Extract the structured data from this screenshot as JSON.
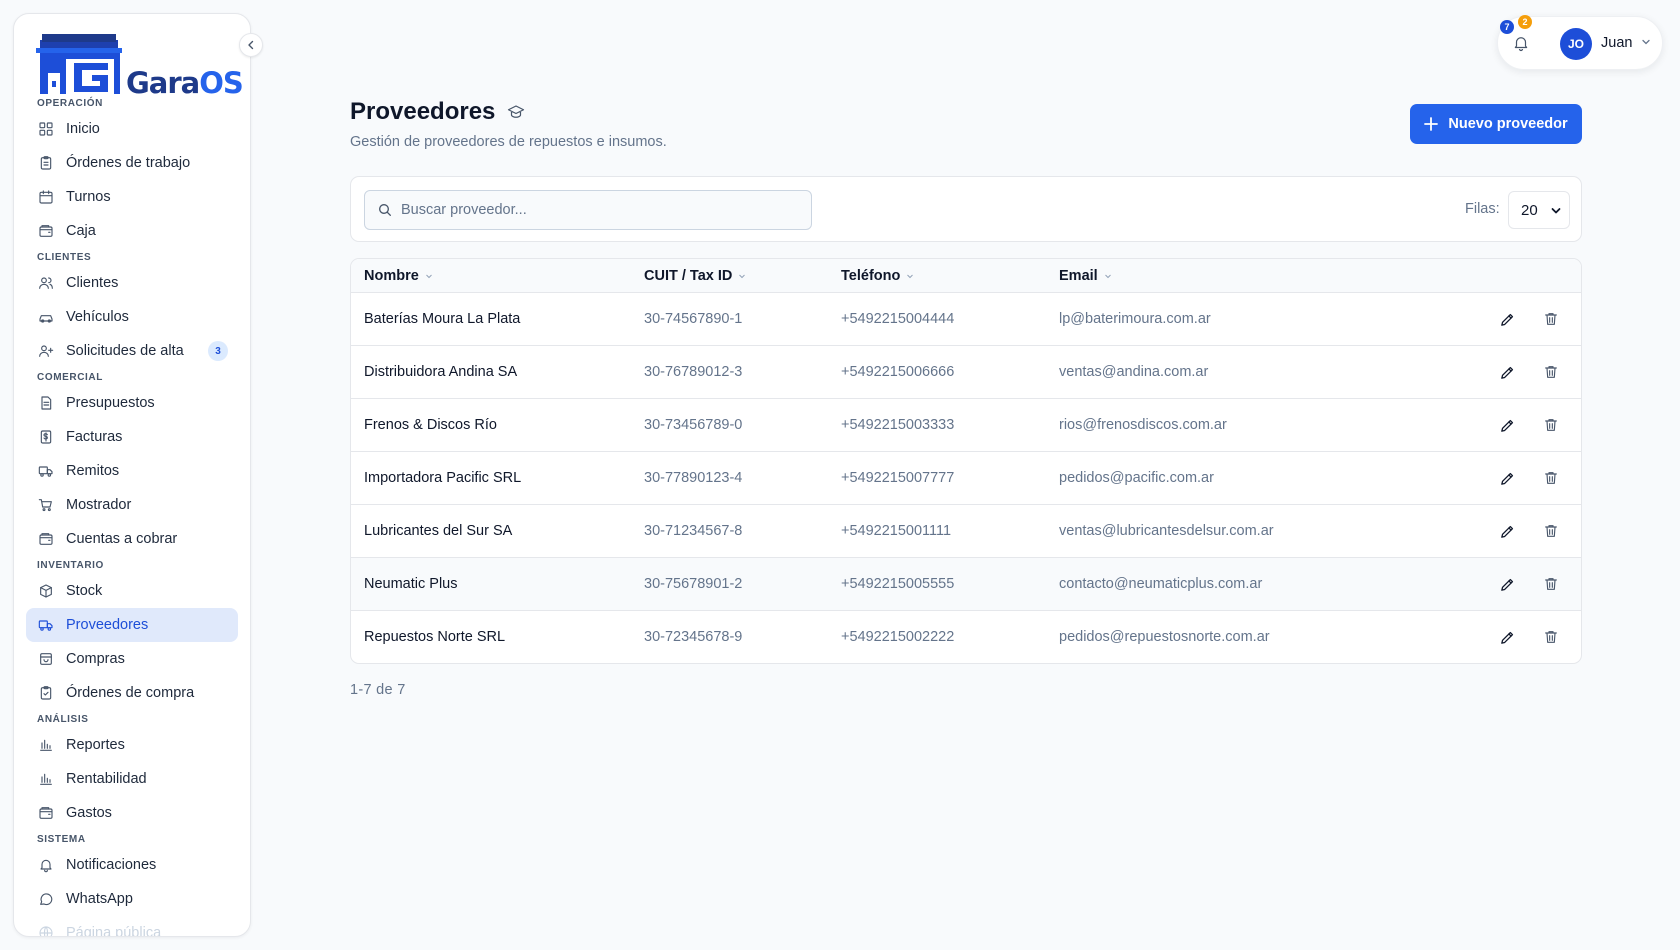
{
  "brand": {
    "name_main": "Gara",
    "name_accent": "OS",
    "accent_color": "#2563eb",
    "dark_color": "#1e3a8a"
  },
  "sidebar": {
    "sections": [
      {
        "label": "OPERACIÓN",
        "items": [
          {
            "label": "Inicio",
            "icon": "grid-icon"
          },
          {
            "label": "Órdenes de trabajo",
            "icon": "clipboard-icon"
          },
          {
            "label": "Turnos",
            "icon": "calendar-icon"
          },
          {
            "label": "Caja",
            "icon": "wallet-icon"
          }
        ]
      },
      {
        "label": "CLIENTES",
        "items": [
          {
            "label": "Clientes",
            "icon": "users-icon"
          },
          {
            "label": "Vehículos",
            "icon": "car-icon"
          },
          {
            "label": "Solicitudes de alta",
            "icon": "user-plus-icon",
            "badge": "3"
          }
        ]
      },
      {
        "label": "COMERCIAL",
        "items": [
          {
            "label": "Presupuestos",
            "icon": "document-icon"
          },
          {
            "label": "Facturas",
            "icon": "dollar-receipt-icon"
          },
          {
            "label": "Remitos",
            "icon": "truck-icon"
          },
          {
            "label": "Mostrador",
            "icon": "cart-icon"
          },
          {
            "label": "Cuentas a cobrar",
            "icon": "wallet-icon"
          }
        ]
      },
      {
        "label": "INVENTARIO",
        "items": [
          {
            "label": "Stock",
            "icon": "box-icon"
          },
          {
            "label": "Proveedores",
            "icon": "truck-icon",
            "active": true
          },
          {
            "label": "Compras",
            "icon": "bag-icon"
          },
          {
            "label": "Órdenes de compra",
            "icon": "clipboard-check-icon"
          }
        ]
      },
      {
        "label": "ANÁLISIS",
        "items": [
          {
            "label": "Reportes",
            "icon": "bar-chart-icon"
          },
          {
            "label": "Rentabilidad",
            "icon": "bar-chart-icon"
          },
          {
            "label": "Gastos",
            "icon": "wallet-icon"
          }
        ]
      },
      {
        "label": "SISTEMA",
        "items": [
          {
            "label": "Notificaciones",
            "icon": "bell-icon"
          },
          {
            "label": "WhatsApp",
            "icon": "chat-icon"
          },
          {
            "label": "Página pública",
            "icon": "globe-icon",
            "faded": true
          }
        ]
      }
    ]
  },
  "header": {
    "notifications": {
      "blue_count": "7",
      "orange_count": "2"
    },
    "user": {
      "initials": "JO",
      "name": "Juan"
    }
  },
  "main": {
    "title": "Proveedores",
    "subtitle": "Gestión de proveedores de repuestos e insumos.",
    "new_button_label": "Nuevo proveedor",
    "search_placeholder": "Buscar proveedor...",
    "rows_label": "Filas:",
    "rows_value": "20",
    "columns": [
      "Nombre",
      "CUIT / Tax ID",
      "Teléfono",
      "Email"
    ],
    "rows": [
      {
        "name": "Baterías Moura La Plata",
        "cuit": "30-74567890-1",
        "phone": "+5492215004444",
        "email": "lp@baterimoura.com.ar"
      },
      {
        "name": "Distribuidora Andina SA",
        "cuit": "30-76789012-3",
        "phone": "+5492215006666",
        "email": "ventas@andina.com.ar"
      },
      {
        "name": "Frenos & Discos Río",
        "cuit": "30-73456789-0",
        "phone": "+5492215003333",
        "email": "rios@frenosdiscos.com.ar"
      },
      {
        "name": "Importadora Pacific SRL",
        "cuit": "30-77890123-4",
        "phone": "+5492215007777",
        "email": "pedidos@pacific.com.ar"
      },
      {
        "name": "Lubricantes del Sur SA",
        "cuit": "30-71234567-8",
        "phone": "+5492215001111",
        "email": "ventas@lubricantesdelsur.com.ar"
      },
      {
        "name": "Neumatic Plus",
        "cuit": "30-75678901-2",
        "phone": "+5492215005555",
        "email": "contacto@neumaticplus.com.ar",
        "highlighted": true
      },
      {
        "name": "Repuestos Norte SRL",
        "cuit": "30-72345678-9",
        "phone": "+5492215002222",
        "email": "pedidos@repuestosnorte.com.ar"
      }
    ],
    "pagination": "1-7 de 7"
  }
}
